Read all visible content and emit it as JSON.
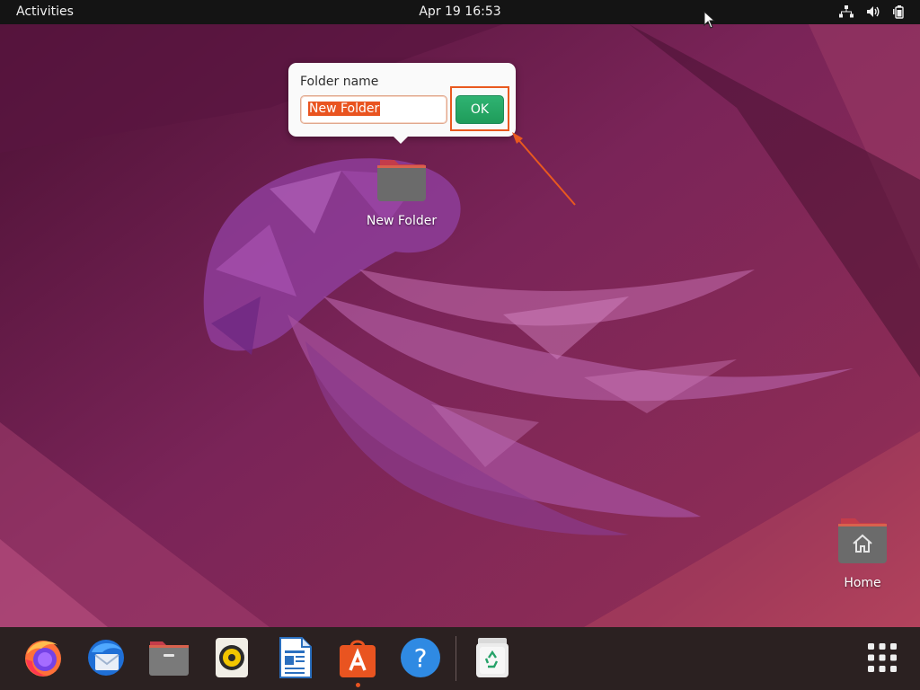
{
  "topbar": {
    "activities": "Activities",
    "clock": "Apr 19  16:53",
    "tray_icons": [
      "network-icon",
      "volume-icon",
      "battery-icon"
    ]
  },
  "popover": {
    "label": "Folder name",
    "input_value": "New Folder",
    "ok_label": "OK"
  },
  "desktop": {
    "icons": [
      {
        "label": "New Folder",
        "icon": "folder-icon"
      },
      {
        "label": "Home",
        "icon": "home-folder-icon"
      }
    ]
  },
  "dock": {
    "apps": [
      "Firefox",
      "Thunderbird",
      "Files",
      "Rhythmbox",
      "LibreOffice Writer",
      "Ubuntu Software",
      "Help",
      "Trash"
    ],
    "show_apps": "show-applications-icon"
  },
  "colors": {
    "accent": "#e95420",
    "ok_green": "#26a269",
    "topbar": "#141414",
    "dock": "#2b2121",
    "annotation": "#e9591f"
  }
}
